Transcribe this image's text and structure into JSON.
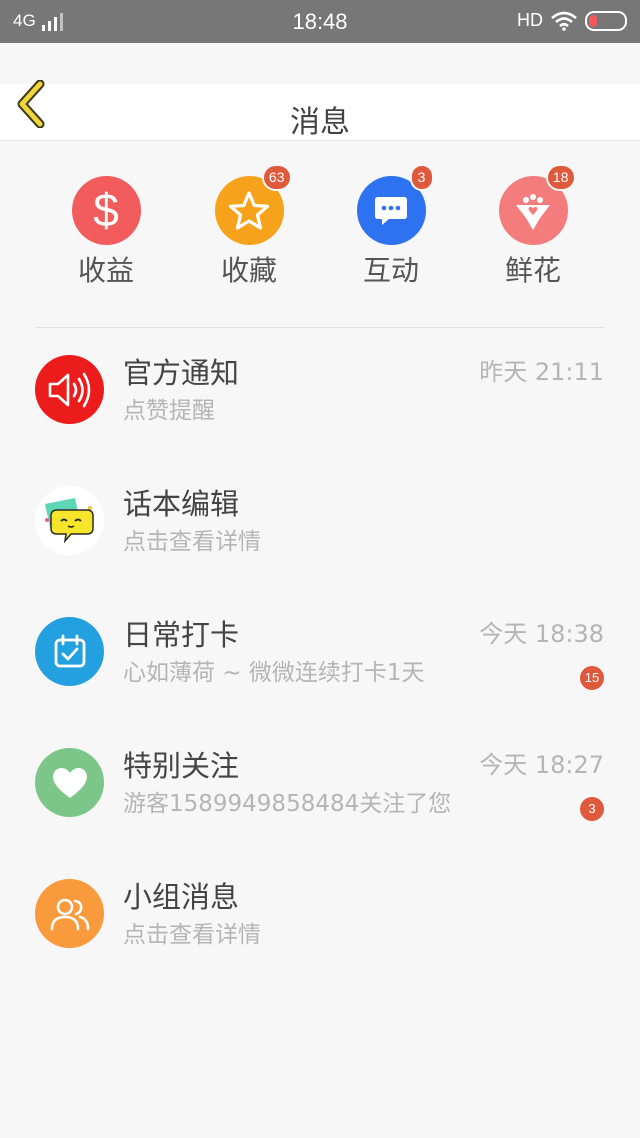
{
  "status_bar": {
    "network": "4G",
    "time": "18:48",
    "hd": "HD"
  },
  "header": {
    "title": "消息"
  },
  "quick_actions": [
    {
      "label": "收益",
      "icon": "dollar-icon",
      "color": "#f35c5c",
      "badge": ""
    },
    {
      "label": "收藏",
      "icon": "star-icon",
      "color": "#f7a21b",
      "badge": "63"
    },
    {
      "label": "互动",
      "icon": "chat-icon",
      "color": "#2d72f0",
      "badge": "3"
    },
    {
      "label": "鲜花",
      "icon": "flower-bouquet-icon",
      "color": "#f57c7c",
      "badge": "18"
    }
  ],
  "messages": [
    {
      "title": "官方通知",
      "subtitle": "点赞提醒",
      "time": "昨天 21:11",
      "badge": "",
      "icon": "speaker-icon",
      "color": "#ec1c1c"
    },
    {
      "title": "话本编辑",
      "subtitle": "点击查看详情",
      "time": "",
      "badge": "",
      "icon": "chat-bubble-face-icon",
      "color": "#ffffff"
    },
    {
      "title": "日常打卡",
      "subtitle": "心如薄荷 ~ 微微连续打卡1天",
      "time": "今天 18:38",
      "badge": "15",
      "icon": "calendar-check-icon",
      "color": "#22a0e0"
    },
    {
      "title": "特别关注",
      "subtitle": "游客1589949858484关注了您",
      "time": "今天 18:27",
      "badge": "3",
      "icon": "heart-icon",
      "color": "#7cc68a"
    },
    {
      "title": "小组消息",
      "subtitle": "点击查看详情",
      "time": "",
      "badge": "",
      "icon": "users-icon",
      "color": "#f99a3c"
    }
  ]
}
